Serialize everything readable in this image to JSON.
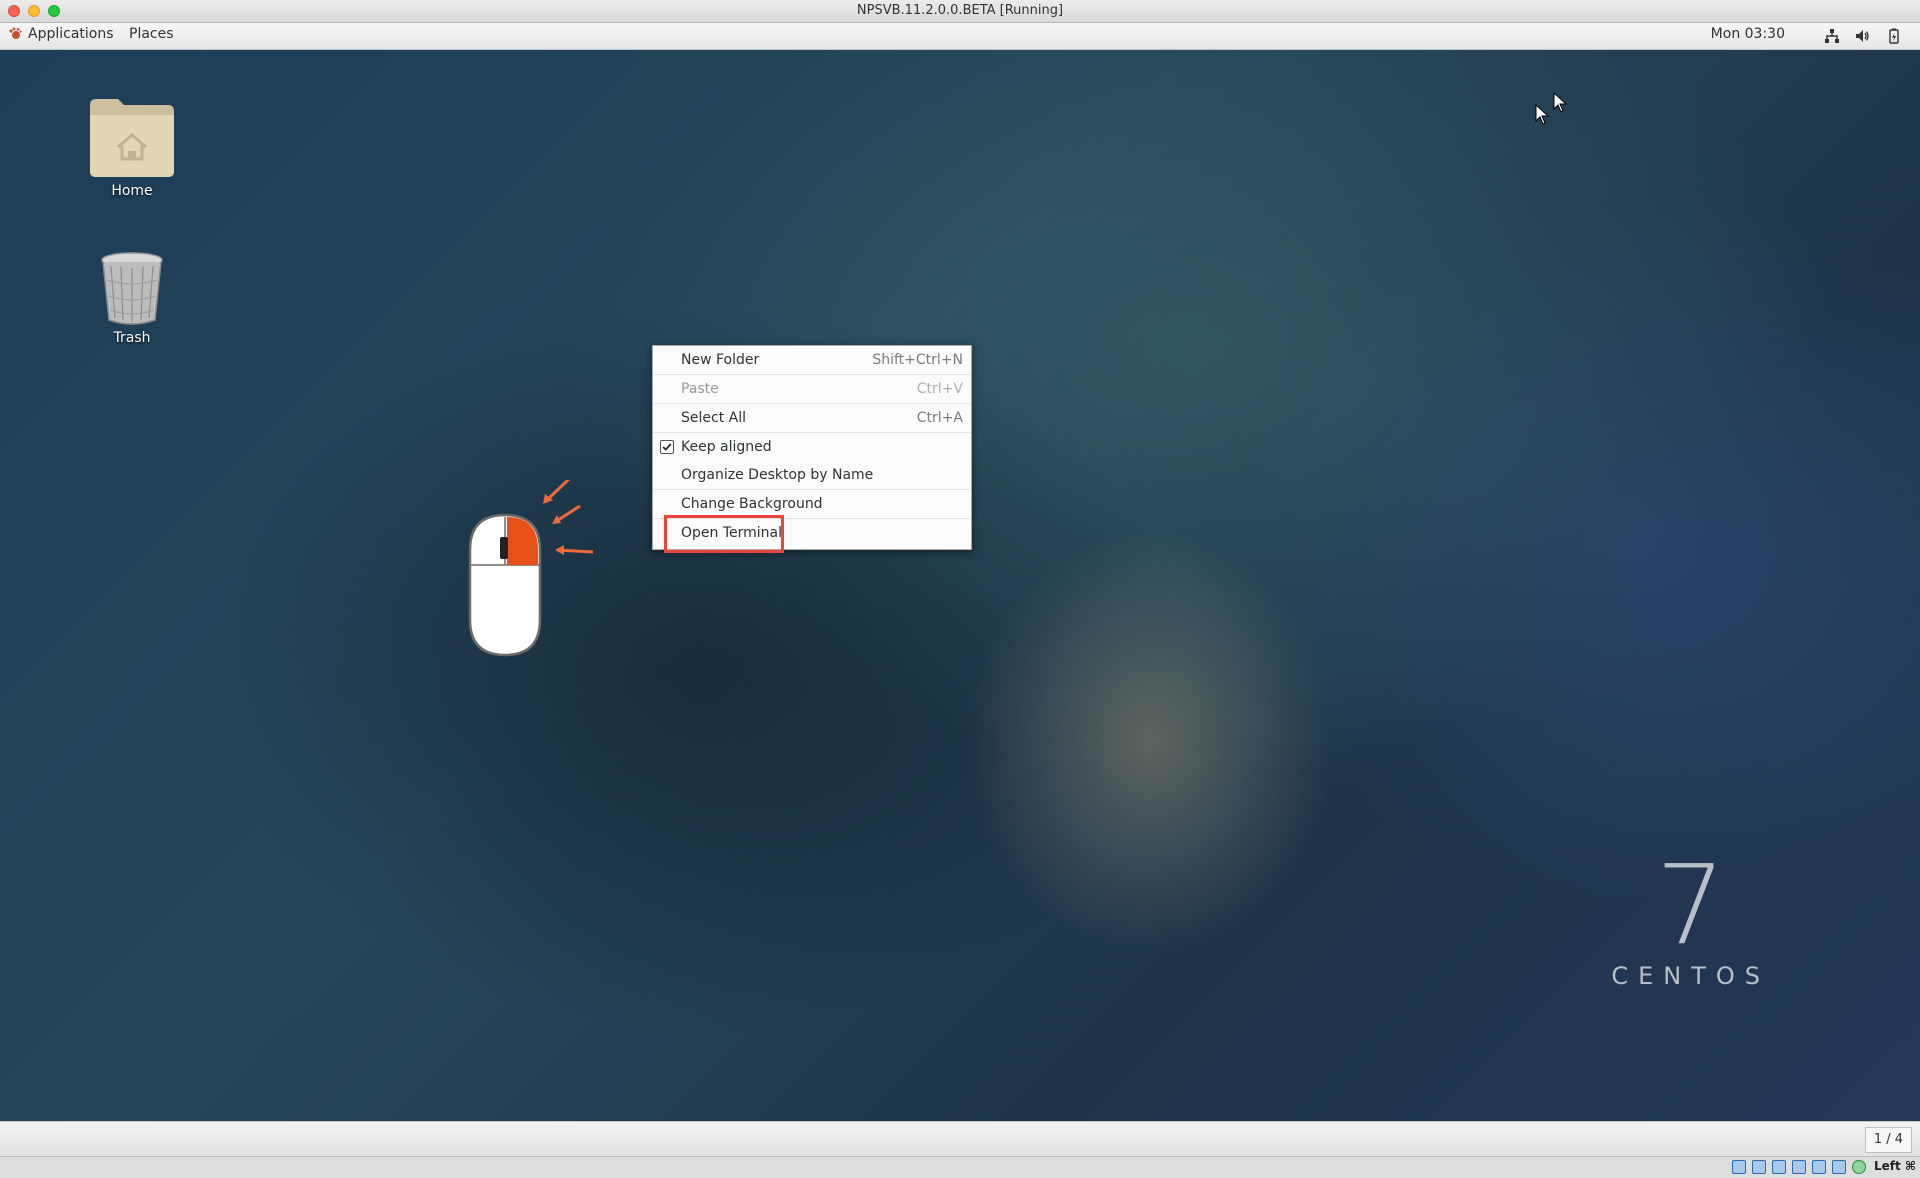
{
  "window": {
    "title": "NPSVB.11.2.0.0.BETA [Running]"
  },
  "topbar": {
    "applications_label": "Applications",
    "places_label": "Places",
    "clock": "Mon 03:30",
    "tray_icons": [
      "network-icon",
      "volume-icon",
      "battery-icon"
    ]
  },
  "desktop": {
    "icons": [
      {
        "label": "Home",
        "icon": "home-folder-icon"
      },
      {
        "label": "Trash",
        "icon": "trash-icon"
      }
    ],
    "watermark": {
      "number": "7",
      "word": "CENTOS"
    }
  },
  "context_menu": {
    "items": [
      {
        "label": "New Folder",
        "accel": "Shift+Ctrl+N",
        "enabled": true
      },
      {
        "label": "Paste",
        "accel": "Ctrl+V",
        "enabled": false
      },
      {
        "label": "Select All",
        "accel": "Ctrl+A",
        "enabled": true
      },
      {
        "label": "Keep aligned",
        "accel": "",
        "enabled": true,
        "checked": true
      },
      {
        "label": "Organize Desktop by Name",
        "accel": "",
        "enabled": true
      },
      {
        "label": "Change Background",
        "accel": "",
        "enabled": true
      },
      {
        "label": "Open Terminal",
        "accel": "",
        "enabled": true,
        "highlighted": true
      }
    ]
  },
  "bottombar": {
    "workspace": "1 / 4"
  },
  "statusbar": {
    "host_key": "Left ⌘"
  },
  "colors": {
    "highlight": "#e8453c",
    "mouse_button": "#e8501a"
  }
}
